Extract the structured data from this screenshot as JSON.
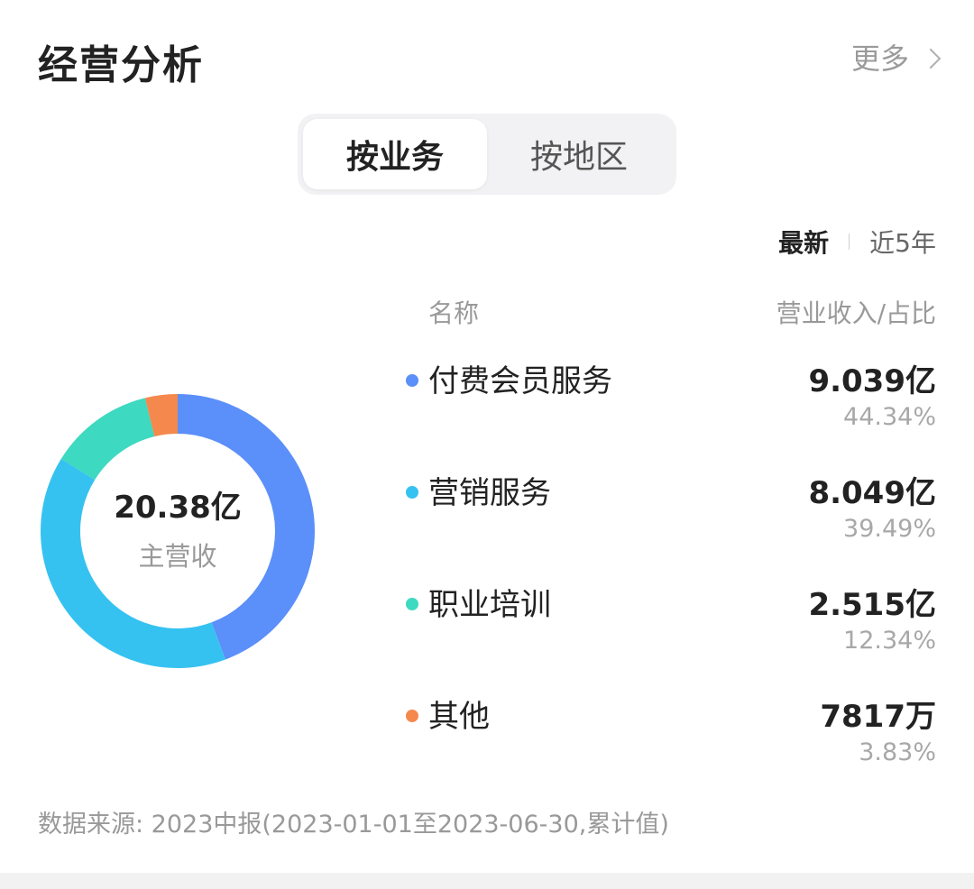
{
  "header": {
    "title": "经营分析",
    "more_label": "更多"
  },
  "tabs": [
    {
      "label": "按业务",
      "active": true
    },
    {
      "label": "按地区",
      "active": false
    }
  ],
  "period": {
    "options": [
      "最新",
      "近5年"
    ],
    "selected": "最新"
  },
  "table": {
    "col_name": "名称",
    "col_value": "营业收入/占比"
  },
  "center": {
    "total": "20.38亿",
    "label": "主营收"
  },
  "items": [
    {
      "name": "付费会员服务",
      "value": "9.039亿",
      "pct": "44.34%",
      "color": "#5b8ff9"
    },
    {
      "name": "营销服务",
      "value": "8.049亿",
      "pct": "39.49%",
      "color": "#36c2f0"
    },
    {
      "name": "职业培训",
      "value": "2.515亿",
      "pct": "12.34%",
      "color": "#3dd9c1"
    },
    {
      "name": "其他",
      "value": "7817万",
      "pct": "3.83%",
      "color": "#f5884d"
    }
  ],
  "chart_data": {
    "type": "pie",
    "categories": [
      "付费会员服务",
      "营销服务",
      "职业培训",
      "其他"
    ],
    "values": [
      44.34,
      39.49,
      12.34,
      3.83
    ],
    "colors": [
      "#5b8ff9",
      "#36c2f0",
      "#3dd9c1",
      "#f5884d"
    ],
    "title": "",
    "style": "donut"
  },
  "source": "数据来源: 2023中报(2023-01-01至2023-06-30,累计值)"
}
